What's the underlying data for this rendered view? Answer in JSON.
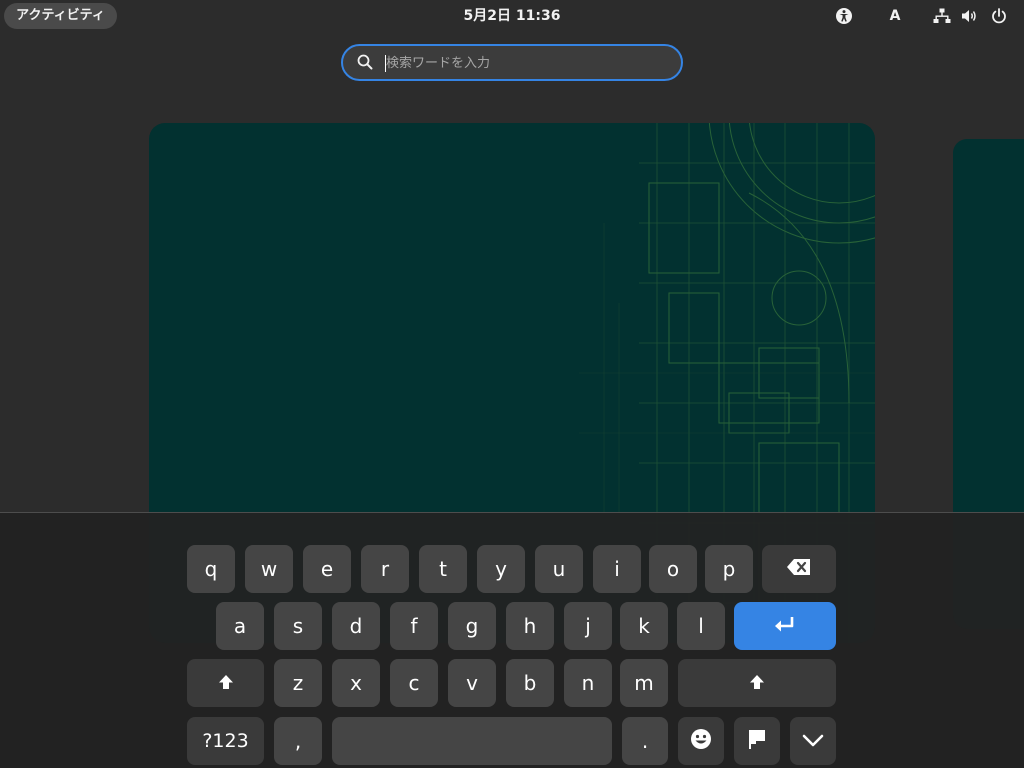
{
  "topbar": {
    "activities_label": "アクティビティ",
    "clock": "5月2日  11:36",
    "accessibility_icon": "accessibility-icon",
    "input_source_label": "A",
    "network_icon": "network-wired-icon",
    "volume_icon": "volume-icon",
    "power_icon": "power-icon"
  },
  "search": {
    "placeholder": "検索ワードを入力",
    "value": "",
    "icon": "search-icon"
  },
  "keyboard": {
    "row1": [
      "q",
      "w",
      "e",
      "r",
      "t",
      "y",
      "u",
      "i",
      "o",
      "p"
    ],
    "row2": [
      "a",
      "s",
      "d",
      "f",
      "g",
      "h",
      "j",
      "k",
      "l"
    ],
    "row3": [
      "z",
      "x",
      "c",
      "v",
      "b",
      "n",
      "m"
    ],
    "numbers_label": "?123",
    "comma_label": ",",
    "period_label": ".",
    "backspace_icon": "backspace-icon",
    "enter_icon": "enter-icon",
    "shift_icon": "shift-icon",
    "emoji_icon": "emoji-icon",
    "language_icon": "flag-icon",
    "hide_icon": "chevron-down-icon"
  },
  "colors": {
    "accent": "#3584e4",
    "workspace_bg": "#023130",
    "panel_bg": "#2c2c2c",
    "key_bg": "#454545"
  }
}
